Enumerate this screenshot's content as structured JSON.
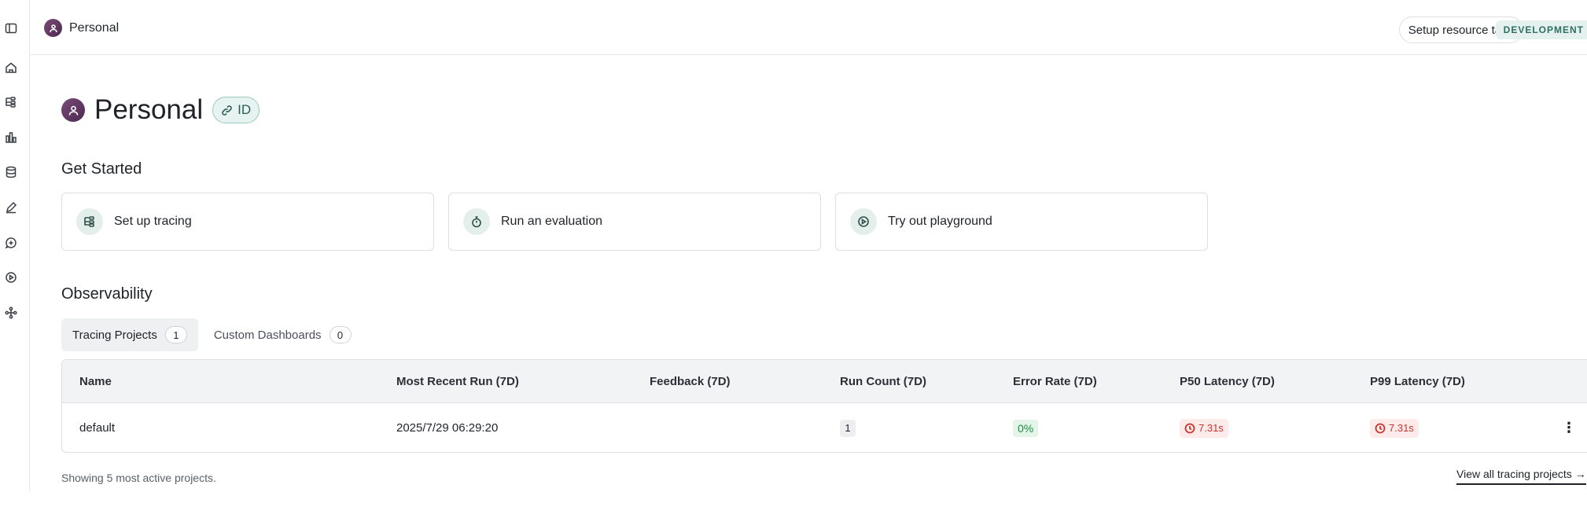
{
  "topbar": {
    "breadcrumb": "Personal",
    "setup_tags_label": "Setup resource tags",
    "env_badge": "DEVELOPMENT"
  },
  "page": {
    "title": "Personal",
    "id_badge": "ID"
  },
  "get_started": {
    "title": "Get Started",
    "cards": [
      {
        "label": "Set up tracing",
        "icon": "tracing-icon"
      },
      {
        "label": "Run an evaluation",
        "icon": "stopwatch-icon"
      },
      {
        "label": "Try out playground",
        "icon": "play-circle-icon"
      }
    ]
  },
  "observability": {
    "title": "Observability",
    "tabs": [
      {
        "label": "Tracing Projects",
        "count": "1",
        "active": true
      },
      {
        "label": "Custom Dashboards",
        "count": "0",
        "active": false
      }
    ],
    "table": {
      "headers": [
        "Name",
        "Most Recent Run (7D)",
        "Feedback (7D)",
        "Run Count (7D)",
        "Error Rate (7D)",
        "P50 Latency (7D)",
        "P99 Latency (7D)"
      ],
      "rows": [
        {
          "name": "default",
          "most_recent_run": "2025/7/29 06:29:20",
          "feedback": "",
          "run_count": "1",
          "error_rate": "0%",
          "p50_latency": "7.31s",
          "p99_latency": "7.31s"
        }
      ]
    },
    "footer_note": "Showing 5 most active projects.",
    "view_all_label": "View all tracing projects →"
  },
  "colors": {
    "accent_teal": "#2f6f62",
    "error_green": "#1e8a46",
    "latency_red": "#c9352d"
  }
}
